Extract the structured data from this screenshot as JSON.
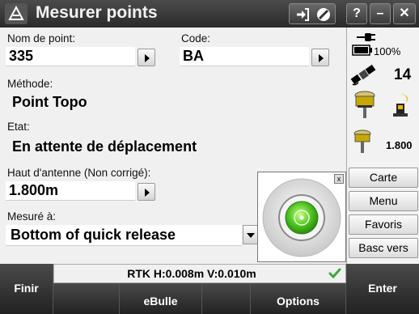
{
  "title_bar": {
    "title": "Mesurer points",
    "help_label": "?",
    "minimize_label": "–",
    "close_label": "✕"
  },
  "form": {
    "point_name": {
      "label": "Nom de point:",
      "value": "335"
    },
    "code": {
      "label": "Code:",
      "value": "BA"
    },
    "method": {
      "label": "Méthode:",
      "value": "Point Topo"
    },
    "state": {
      "label": "Etat:",
      "value": "En attente de déplacement"
    },
    "antenna_height": {
      "label": "Haut d'antenne (Non corrigé):",
      "value": "1.800m"
    },
    "measured_to": {
      "label": "Mesuré à:",
      "value": "Bottom of quick release"
    }
  },
  "right_panel": {
    "battery_percent": "100%",
    "satellite_count": "14",
    "antenna_height": "1.800",
    "buttons": [
      "Carte",
      "Menu",
      "Favoris",
      "Basc vers"
    ]
  },
  "status_bar": {
    "text": "RTK H:0.008m V:0.010m"
  },
  "softkeys": {
    "finish": "Finir",
    "ebubble": "eBulle",
    "options": "Options",
    "enter": "Enter"
  },
  "bubble_popup": {
    "close_label": "x"
  },
  "colors": {
    "title_bar": "#333333",
    "bubble_green": "#4cc21f",
    "check_green": "#3fa63a",
    "softkey_bg": "#2e2e2e"
  }
}
